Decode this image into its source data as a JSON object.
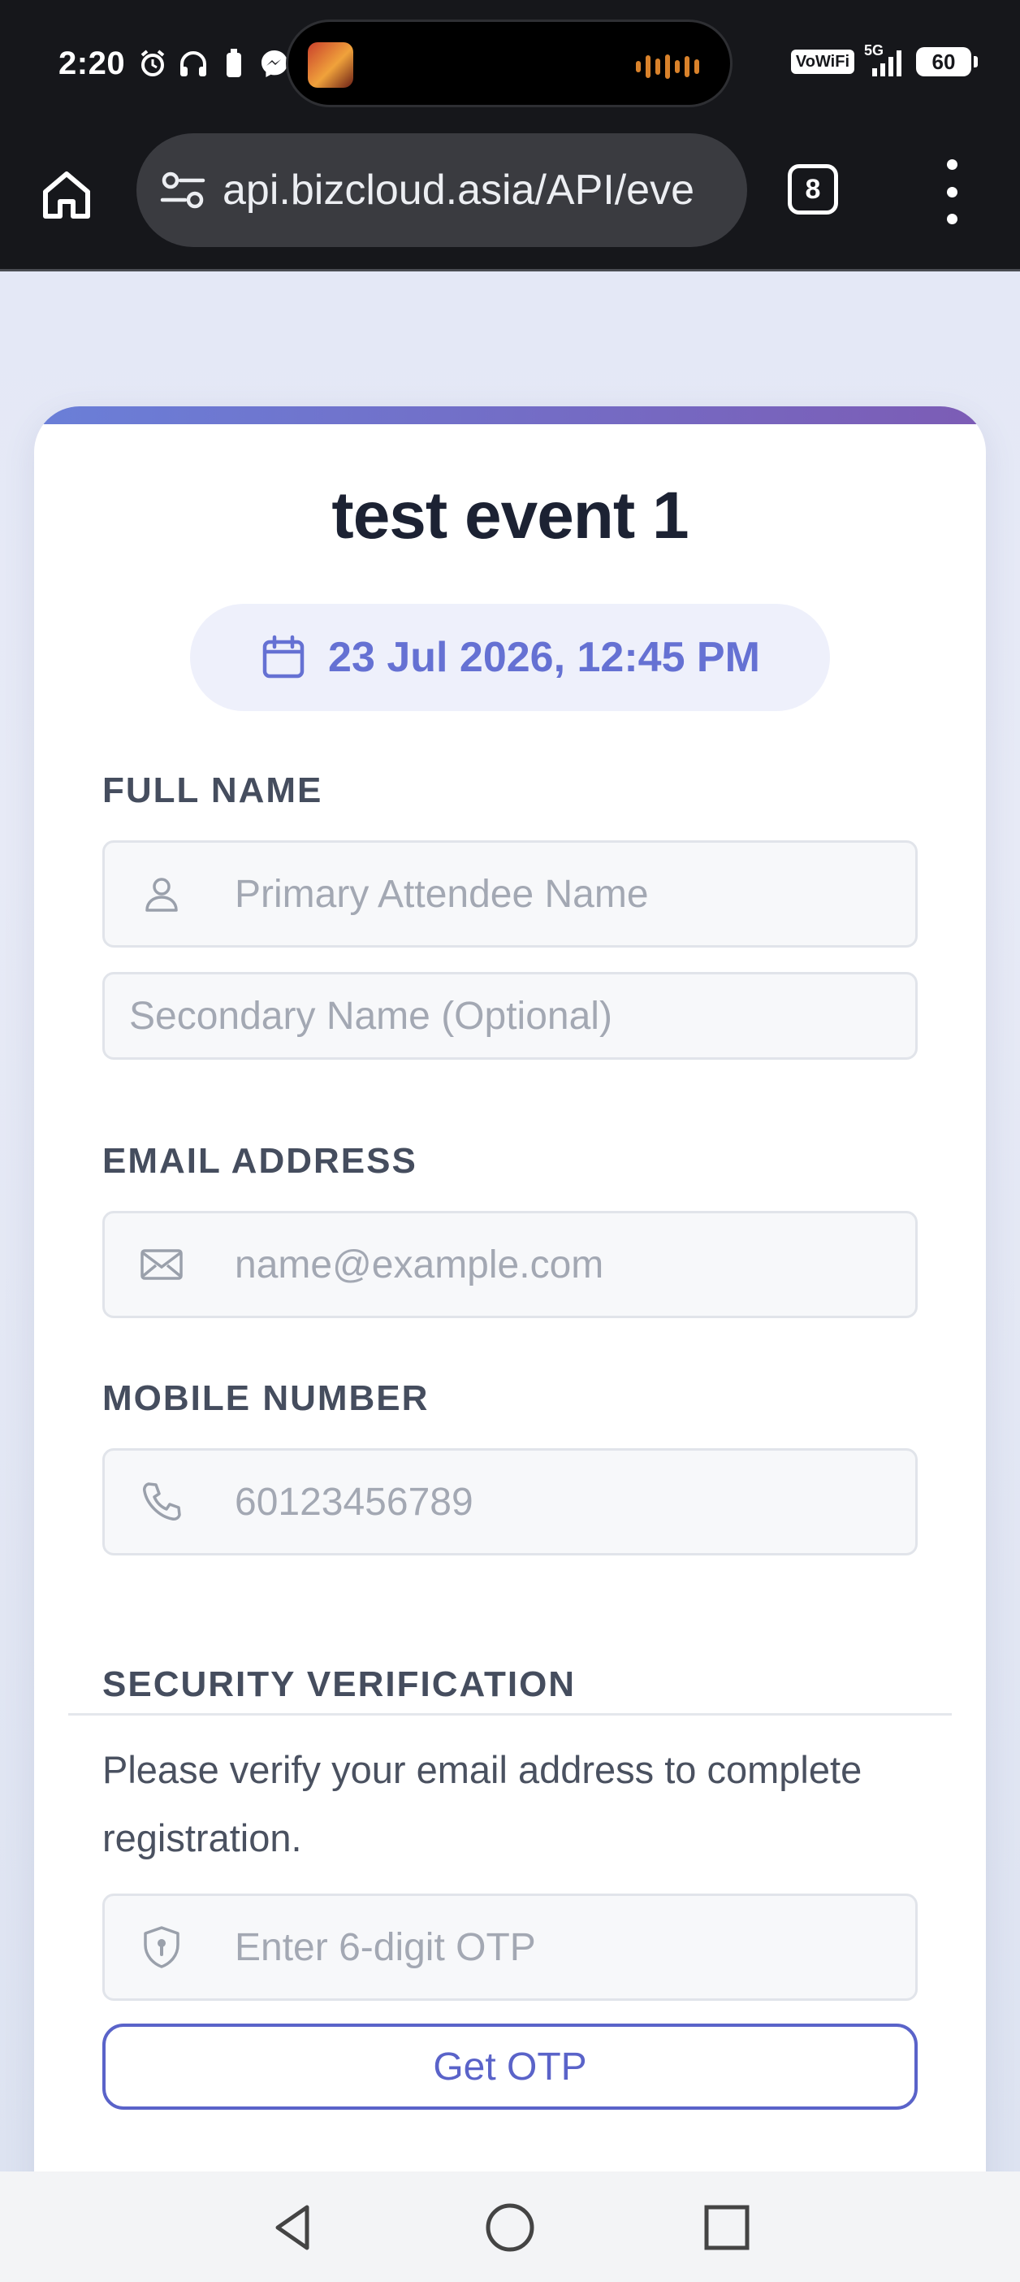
{
  "status_bar": {
    "time": "2:20",
    "left_icons": [
      "alarm-icon",
      "headphones-icon",
      "battery-saver-icon",
      "messenger-icon"
    ],
    "network_label": "VoWiFi",
    "network_type": "5G",
    "battery_level": "60"
  },
  "browser": {
    "url": "api.bizcloud.asia/API/eve",
    "tab_count": "8"
  },
  "event": {
    "title": "test event 1",
    "datetime": "23 Jul 2026, 12:45 PM"
  },
  "form": {
    "full_name_label": "FULL NAME",
    "primary_name_placeholder": "Primary Attendee Name",
    "secondary_name_placeholder": "Secondary Name (Optional)",
    "email_label": "EMAIL ADDRESS",
    "email_placeholder": "name@example.com",
    "mobile_label": "MOBILE NUMBER",
    "mobile_placeholder": "60123456789",
    "security_label": "SECURITY VERIFICATION",
    "security_helper": "Please verify your email address to complete registration.",
    "otp_placeholder": "Enter 6-digit OTP",
    "get_otp_label": "Get OTP"
  },
  "colors": {
    "accent": "#5a63c9",
    "accent_light": "#eef0fb",
    "bar_gradient_start": "#6a7fd8",
    "bar_gradient_end": "#7c5cb5"
  }
}
